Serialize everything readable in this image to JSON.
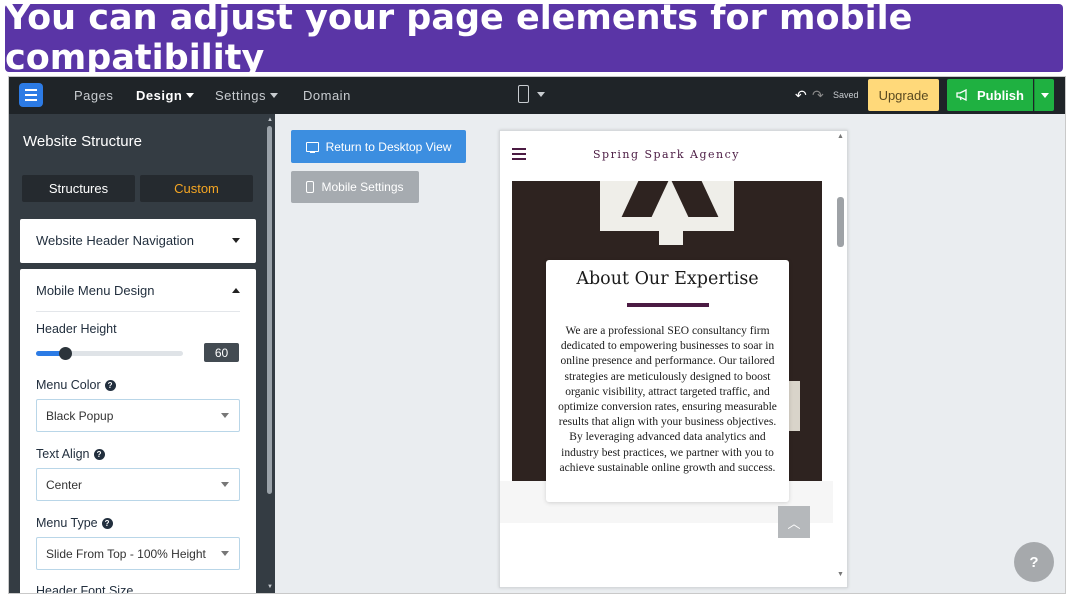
{
  "banner": {
    "text": "You can adjust your page elements for mobile compatibility"
  },
  "topbar": {
    "nav": [
      "Pages",
      "Design",
      "Settings",
      "Domain"
    ],
    "saved": "Saved",
    "upgrade": "Upgrade",
    "publish": "Publish"
  },
  "sidebar": {
    "title": "Website Structure",
    "tabs": [
      "Structures",
      "Custom"
    ],
    "header_nav": "Website Header Navigation",
    "mobile_menu": {
      "title": "Mobile Menu Design",
      "header_height_label": "Header Height",
      "header_height_value": "60",
      "header_height_fraction": 0.2,
      "menu_color_label": "Menu Color",
      "menu_color_value": "Black Popup",
      "text_align_label": "Text Align",
      "text_align_value": "Center",
      "menu_type_label": "Menu Type",
      "menu_type_value": "Slide From Top - 100% Height",
      "header_font_size_label": "Header Font Size"
    }
  },
  "canvas": {
    "return_button": "Return to Desktop View",
    "mobile_settings_button": "Mobile Settings"
  },
  "preview": {
    "agency": "Spring Spark Agency",
    "about_title": "About Our Expertise",
    "about_text": "We are a professional SEO consultancy firm dedicated to empowering businesses to soar in online presence and performance. Our tailored strategies are meticulously designed to boost organic visibility, attract targeted traffic, and optimize conversion rates, ensuring measurable results that align with your business objectives. By leveraging advanced data analytics and industry best practices, we partner with you to achieve sustainable online growth and success.",
    "brand_color": "#4b1b43"
  },
  "help": "?",
  "icons": [
    "menu-icon",
    "mobile-device-icon",
    "undo-icon",
    "redo-icon",
    "megaphone-icon",
    "monitor-icon",
    "phone-icon",
    "help-icon",
    "arrow-up-icon"
  ],
  "colors": {
    "banner": "#5a35a6",
    "topbar": "#1f2428",
    "sidebar": "#343c43",
    "accent": "#2c7be5",
    "publish": "#1fb141",
    "upgrade": "#ffd97a",
    "custom_tab": "#f5a623"
  }
}
